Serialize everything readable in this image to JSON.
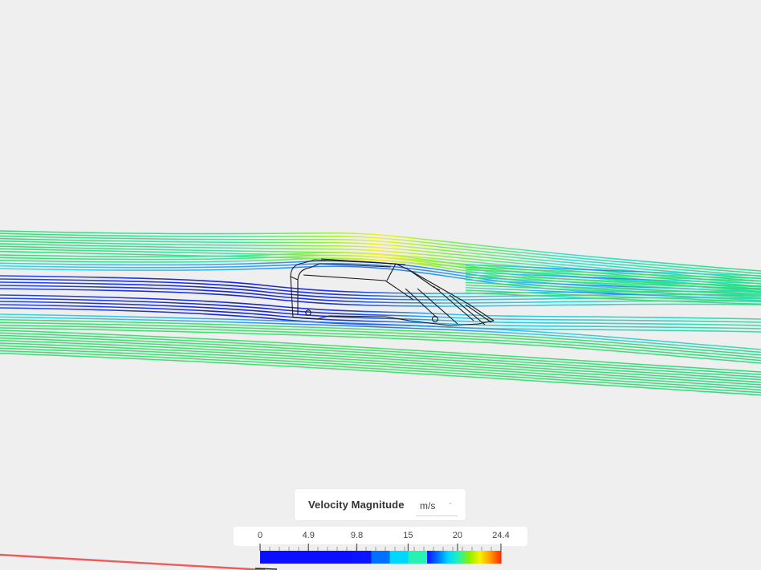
{
  "legend": {
    "title": "Velocity Magnitude",
    "unit": "m/s",
    "tick_labels": [
      "0",
      "4.9",
      "9.8",
      "15",
      "20",
      "24.4"
    ],
    "range": [
      0,
      24.4
    ],
    "colormap": [
      "#0a10ff",
      "#0a10ff",
      "#0a10ff",
      "#0a10ff",
      "#0a10ff",
      "#0b14ff",
      "#0070ff",
      "#00d8ff",
      "#25f1b0",
      "#8cf000",
      "#f5f200",
      "#ff9a00",
      "#ff2a00"
    ]
  },
  "colors": {
    "background": "#efefef",
    "streamline_fast": "#18e070",
    "streamline_mid": "#28d8c8",
    "streamline_slow": "#0a10ff",
    "geometry_outline": "#222222",
    "axis_line": "#ee5b5b"
  }
}
